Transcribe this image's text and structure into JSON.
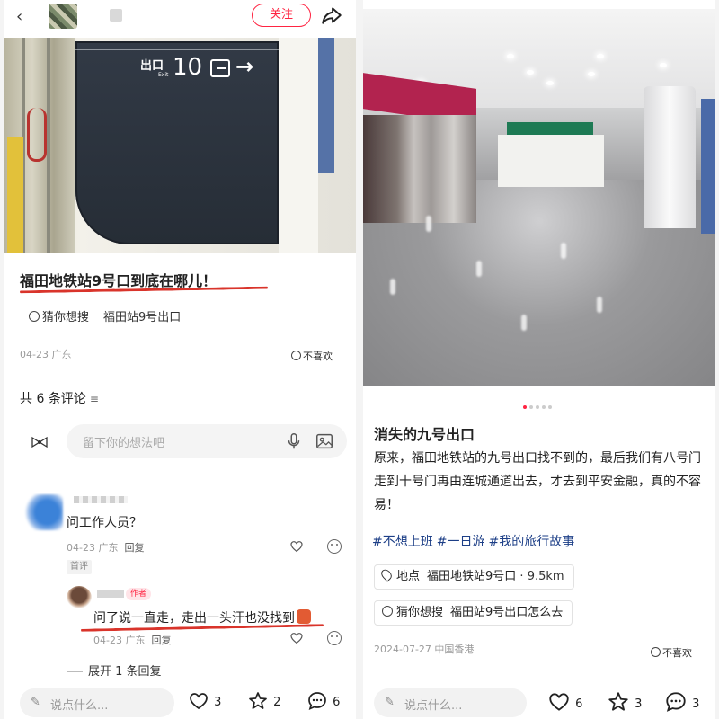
{
  "left": {
    "follow_label": "关注",
    "sign": {
      "exit": "出口",
      "exit_en": "Exit",
      "number": "10",
      "arrow": "→"
    },
    "post_title": "福田地铁站9号口到底在哪儿！",
    "suggest": {
      "label": "猜你想搜",
      "term": "福田站9号出口"
    },
    "date_location": "04-23 广东",
    "dislike_label": "不喜欢",
    "comment_count": "共 6 条评论",
    "filter_icon": "≡",
    "comment_placeholder": "留下你的想法吧",
    "comments": [
      {
        "text": "问工作人员？",
        "meta": "04-23 广东",
        "reply": "回复",
        "tag": "首评"
      },
      {
        "author_badge": "作者",
        "text": "问了说一直走，走出一头汗也没找到",
        "meta": "04-23 广东",
        "reply": "回复"
      }
    ],
    "expand_label": "展开 1 条回复",
    "bottom": {
      "placeholder": "说点什么...",
      "likes": "3",
      "favorites": "2",
      "comments": "6"
    }
  },
  "right": {
    "title": "消失的九号出口",
    "body": "原来，福田地铁站的九号出口找不到的，最后我们有八号门走到十号门再由连城通道出去，才去到平安金融，真的不容易！",
    "tags": [
      "#不想上班",
      "#一日游",
      "#我的旅行故事"
    ],
    "location": {
      "label": "地点",
      "name": "福田地铁站9号口",
      "distance": "9.5km"
    },
    "suggest": {
      "label": "猜你想搜",
      "term": "福田站9号出口怎么去"
    },
    "date_location": "2024-07-27 中国香港",
    "dislike_label": "不喜欢",
    "bottom": {
      "placeholder": "说点什么...",
      "likes": "6",
      "favorites": "3",
      "comments": "3"
    }
  },
  "colors": {
    "accent": "#ff2442",
    "tag_blue": "#1d3f87",
    "underline": "#d9342b"
  }
}
